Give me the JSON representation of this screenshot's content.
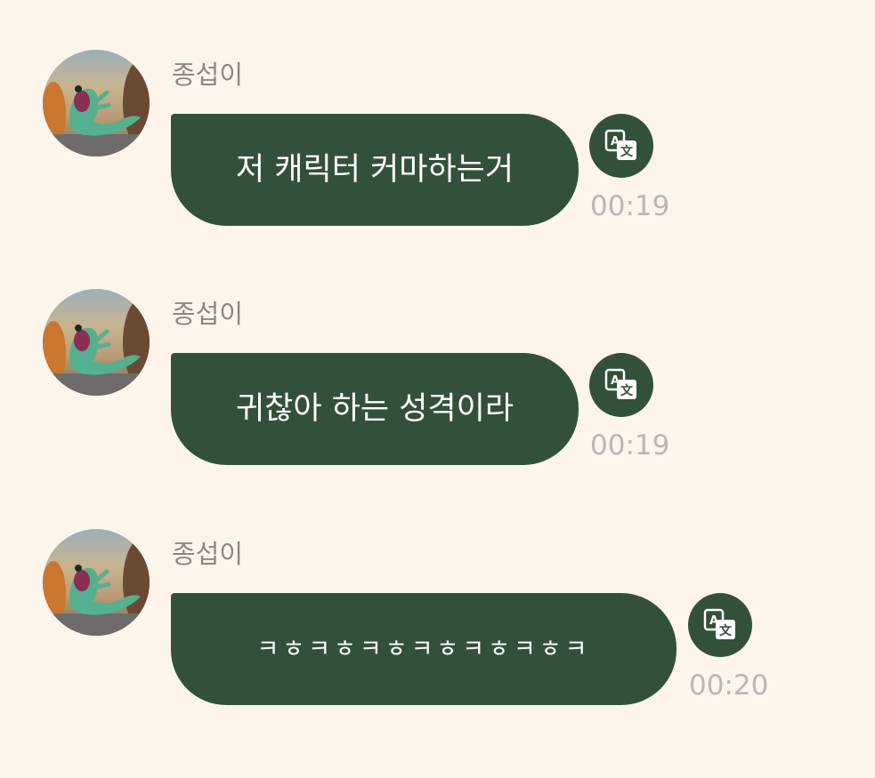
{
  "messages": [
    {
      "sender": "종섭이",
      "text": "저 캐릭터 커마하는거",
      "time": "00:19"
    },
    {
      "sender": "종섭이",
      "text": "귀찮아 하는 성격이라",
      "time": "00:19"
    },
    {
      "sender": "종섭이",
      "text": "ㅋㅎㅋㅎㅋㅎㅋㅎㅋㅎㅋㅎㅋ",
      "time": "00:20"
    }
  ],
  "icons": {
    "avatar": "dinosaur-profile-photo",
    "translate": "translate-icon"
  },
  "colors": {
    "background": "#FDF5EC",
    "bubble": "#33513A",
    "bubble_text": "#FFFFFF",
    "sender_text": "#8C8783",
    "time_text": "#B9B6B5"
  }
}
